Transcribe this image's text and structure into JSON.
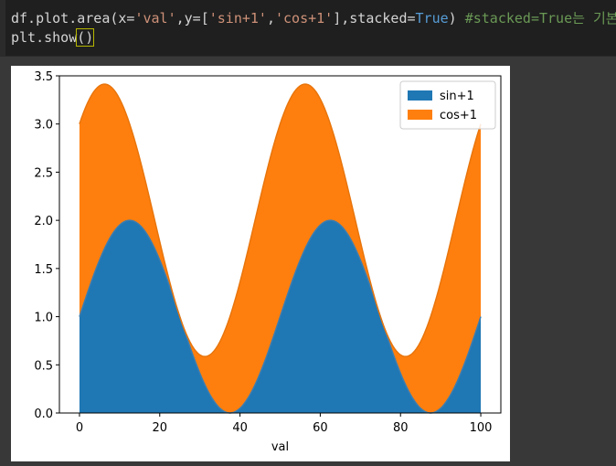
{
  "code_cell": {
    "line1_code": "df.plot.area(x=",
    "line1_arg1": "'val'",
    "line1_mid": ",y=[",
    "line1_arg2": "'sin+1'",
    "line1_comma": ",",
    "line1_arg3": "'cos+1'",
    "line1_mid2": "],stacked=",
    "line1_true": "True",
    "line1_close": ")",
    "line1_comment": " #stacked=True는 기본값",
    "line2_code": "plt.show",
    "line2_paren": "()"
  },
  "colors": {
    "series_blue": "#1f77b4",
    "series_orange": "#ff7f0e"
  },
  "chart_data": {
    "type": "area",
    "stacked": true,
    "xlabel": "val",
    "ylabel": "",
    "title": "",
    "xlim": [
      0,
      100
    ],
    "ylim": [
      0,
      3.5
    ],
    "x_ticks": [
      "0",
      "20",
      "40",
      "60",
      "80",
      "100"
    ],
    "y_ticks": [
      "0.0",
      "0.5",
      "1.0",
      "1.5",
      "2.0",
      "2.5",
      "3.0",
      "3.5"
    ],
    "legend_position": "top-right",
    "x": [
      0,
      5,
      10,
      15,
      20,
      25,
      30,
      35,
      40,
      45,
      50,
      55,
      60,
      65,
      70,
      75,
      80,
      85,
      90,
      95,
      100
    ],
    "series": [
      {
        "name": "sin+1",
        "color": "#1f77b4",
        "values": [
          1.0,
          1.59,
          1.95,
          1.95,
          1.59,
          1.0,
          0.41,
          0.05,
          0.05,
          0.41,
          1.0,
          1.59,
          1.95,
          1.95,
          1.59,
          1.0,
          0.41,
          0.05,
          0.05,
          0.41,
          1.0
        ]
      },
      {
        "name": "cos+1",
        "color": "#ff7f0e",
        "values": [
          2.0,
          1.81,
          1.31,
          0.69,
          0.19,
          0.0,
          0.19,
          0.69,
          1.31,
          1.81,
          2.0,
          1.81,
          1.31,
          0.69,
          0.19,
          0.0,
          0.19,
          0.69,
          1.31,
          1.81,
          2.0
        ]
      }
    ],
    "legend": [
      "sin+1",
      "cos+1"
    ]
  }
}
